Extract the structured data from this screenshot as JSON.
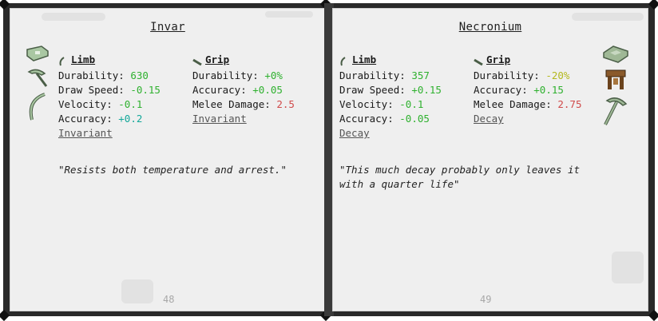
{
  "left_page": {
    "title": "Invar",
    "limb": {
      "header": "Limb",
      "stats": [
        {
          "label": "Durability:",
          "value": "630",
          "color": "green"
        },
        {
          "label": "Draw Speed:",
          "value": "-0.15",
          "color": "green"
        },
        {
          "label": "Velocity:",
          "value": "-0.1",
          "color": "green"
        },
        {
          "label": "Accuracy:",
          "value": "+0.2",
          "color": "cyan"
        }
      ],
      "trait": "Invariant"
    },
    "grip": {
      "header": "Grip",
      "stats": [
        {
          "label": "Durability:",
          "value": "+0%",
          "color": "green"
        },
        {
          "label": "Accuracy:",
          "value": "+0.05",
          "color": "green"
        },
        {
          "label": "Melee Damage:",
          "value": "2.5",
          "color": "red"
        }
      ],
      "trait": "Invariant"
    },
    "quote": "\"Resists both temperature and arrest.\"",
    "page_number": "48",
    "icons": [
      "tool-rod-icon",
      "pickaxe-head-icon",
      "bow-limb-icon"
    ]
  },
  "right_page": {
    "title": "Necronium",
    "limb": {
      "header": "Limb",
      "stats": [
        {
          "label": "Durability:",
          "value": "357",
          "color": "green"
        },
        {
          "label": "Draw Speed:",
          "value": "+0.15",
          "color": "green"
        },
        {
          "label": "Velocity:",
          "value": "-0.1",
          "color": "green"
        },
        {
          "label": "Accuracy:",
          "value": "-0.05",
          "color": "green"
        }
      ],
      "trait": "Decay"
    },
    "grip": {
      "header": "Grip",
      "stats": [
        {
          "label": "Durability:",
          "value": "-20%",
          "color": "yellow"
        },
        {
          "label": "Accuracy:",
          "value": "+0.15",
          "color": "green"
        },
        {
          "label": "Melee Damage:",
          "value": "2.75",
          "color": "red"
        }
      ],
      "trait": "Decay"
    },
    "quote_line1": "\"This much decay probably only leaves it",
    "quote_line2": "with a quarter life\"",
    "page_number": "49",
    "icons": [
      "ingot-icon",
      "crafting-table-icon",
      "pickaxe-icon"
    ]
  },
  "colors": {
    "green": "#2fb12f",
    "cyan": "#14a89a",
    "yellow": "#b4b81e",
    "red": "#d04a4a",
    "icon_green": "#8fb08a"
  }
}
